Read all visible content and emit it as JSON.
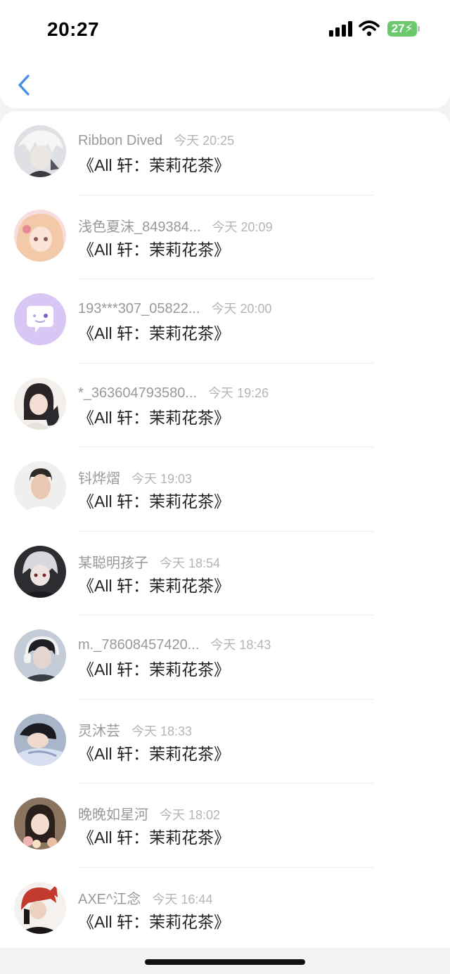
{
  "status_bar": {
    "time": "20:27",
    "battery": "27"
  },
  "nav": {
    "back_icon": "chevron-left-icon",
    "accent_color": "#4a90e2"
  },
  "messages": [
    {
      "name": "Ribbon Dived",
      "time": "今天 20:25",
      "text": "《All 轩：茉莉花茶》",
      "avatar": "anime-avatar-silver"
    },
    {
      "name": "浅色夏沫_849384...",
      "time": "今天 20:09",
      "text": "《All 轩：茉莉花茶》",
      "avatar": "anime-avatar-pink"
    },
    {
      "name": "193***307_05822...",
      "time": "今天 20:00",
      "text": "《All 轩：茉莉花茶》",
      "avatar": "default-chat-avatar"
    },
    {
      "name": "*_363604793580...",
      "time": "今天 19:26",
      "text": "《All 轩：茉莉花茶》",
      "avatar": "girl-with-cat-avatar"
    },
    {
      "name": "钭烨熠",
      "time": "今天 19:03",
      "text": "《All 轩：茉莉花茶》",
      "avatar": "man-photo-avatar"
    },
    {
      "name": "某聪明孩子",
      "time": "今天 18:54",
      "text": "《All 轩：茉莉花茶》",
      "avatar": "anime-avatar-dark"
    },
    {
      "name": "m._78608457420...",
      "time": "今天 18:43",
      "text": "《All 轩：茉莉花茶》",
      "avatar": "headphones-avatar"
    },
    {
      "name": "灵沐芸",
      "time": "今天 18:33",
      "text": "《All 轩：茉莉花茶》",
      "avatar": "sleeping-boy-avatar"
    },
    {
      "name": "晚晚如星河",
      "time": "今天 18:02",
      "text": "《All 轩：茉莉花茶》",
      "avatar": "girl-flowers-avatar"
    },
    {
      "name": "AXE^江念",
      "time": "今天 16:44",
      "text": "《All 轩：茉莉花茶》",
      "avatar": "red-hood-avatar"
    }
  ]
}
